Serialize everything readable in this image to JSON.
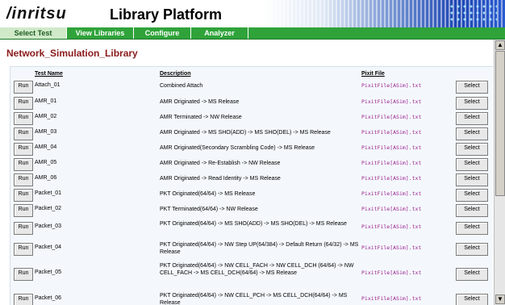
{
  "header": {
    "logo": "/inritsu",
    "title": "Library Platform"
  },
  "tabs": [
    {
      "label": "Select Test",
      "active": true
    },
    {
      "label": "View Libraries",
      "active": false
    },
    {
      "label": "Configure",
      "active": false
    },
    {
      "label": "Analyzer",
      "active": false
    }
  ],
  "library_title": "Network_Simulation_Library",
  "table": {
    "headers": {
      "name": "Test Name",
      "description": "Description",
      "pixit": "Pixit File"
    },
    "run_label": "Run",
    "select_label": "Select",
    "rows": [
      {
        "name": "Attach_01",
        "description": "Combined Attach",
        "pixit": "PixitFile[ASim].txt"
      },
      {
        "name": "AMR_01",
        "description": "AMR Originated -> MS Release",
        "pixit": "PixitFile[ASim].txt"
      },
      {
        "name": "AMR_02",
        "description": "AMR Terminated -> NW Release",
        "pixit": "PixitFile[ASim].txt"
      },
      {
        "name": "AMR_03",
        "description": "AMR Originated -> MS SHO(ADD) -> MS SHO(DEL) -> MS Release",
        "pixit": "PixitFile[ASim].txt"
      },
      {
        "name": "AMR_04",
        "description": "AMR Originated(Secondary Scrambling Code) -> MS Release",
        "pixit": "PixitFile[ASim].txt"
      },
      {
        "name": "AMR_05",
        "description": "AMR Originated -> Re-Establish -> NW Release",
        "pixit": "PixitFile[ASim].txt"
      },
      {
        "name": "AMR_06",
        "description": "AMR Originated -> Read Identity -> MS Release",
        "pixit": "PixitFile[ASim].txt"
      },
      {
        "name": "Packet_01",
        "description": "PKT Originated(64/64) -> MS Release",
        "pixit": "PixitFile[ASim].txt"
      },
      {
        "name": "Packet_02",
        "description": "PKT Terminated(64/64) -> NW Release",
        "pixit": "PixitFile[ASim].txt"
      },
      {
        "name": "Packet_03",
        "description": "PKT Originated(64/64) -> MS SHO(ADD) -> MS SHO(DEL) -> MS Release",
        "pixit": "PixitFile[ASim].txt"
      },
      {
        "name": "Packet_04",
        "description": "PKT Originated(64/64) -> NW Step UP(64/384) -> Default Return (64/32) -> MS Release",
        "pixit": "PixitFile[ASim].txt"
      },
      {
        "name": "Packet_05",
        "description": "PKT Originated(64/64) -> NW CELL_FACH -> NW CELL_DCH (64/64) -> NW CELL_FACH -> MS CELL_DCH(64/64) -> MS Release",
        "pixit": "PixitFile[ASim].txt"
      },
      {
        "name": "Packet_06",
        "description": "PKT Originated(64/64) -> NW CELL_PCH -> MS CELL_DCH(64/64) -> MS Release",
        "pixit": "PixitFile[ASim].txt"
      }
    ]
  },
  "scrollbar": {
    "up_icon": "▲",
    "down_icon": "▼"
  }
}
